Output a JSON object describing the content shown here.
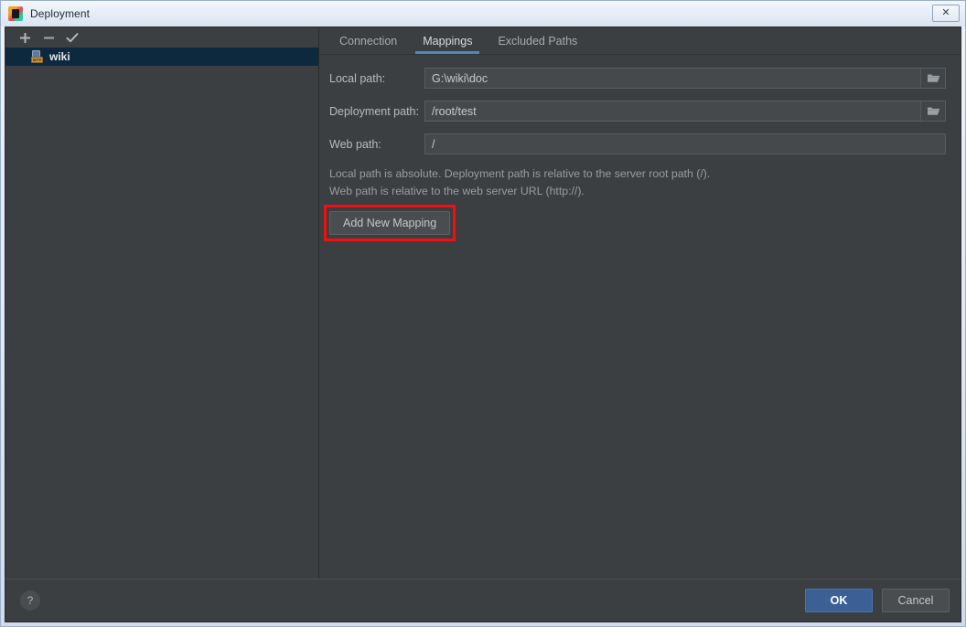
{
  "window": {
    "title": "Deployment",
    "app_icon": "pycharm-icon",
    "close_label": "✕"
  },
  "left_panel": {
    "toolbar": [
      {
        "name": "add-server-button",
        "icon": "plus-icon",
        "label": "+"
      },
      {
        "name": "remove-server-button",
        "icon": "minus-icon",
        "label": "−"
      },
      {
        "name": "use-as-default-button",
        "icon": "check-icon",
        "label": "✓"
      }
    ],
    "servers": [
      {
        "label": "wiki",
        "icon": "sftp-server-icon",
        "badge": "SFTP",
        "selected": true
      }
    ]
  },
  "tabs": [
    {
      "label": "Connection",
      "active": false
    },
    {
      "label": "Mappings",
      "active": true
    },
    {
      "label": "Excluded Paths",
      "active": false
    }
  ],
  "mappings_form": {
    "fields": [
      {
        "label": "Local path:",
        "value": "G:\\wiki\\doc",
        "placeholder": "",
        "has_browse": true,
        "name": "local-path"
      },
      {
        "label": "Deployment path:",
        "value": "/root/test",
        "placeholder": "",
        "has_browse": true,
        "name": "deployment-path"
      },
      {
        "label": "Web path:",
        "value": "/",
        "placeholder": "",
        "has_browse": false,
        "name": "web-path"
      }
    ],
    "hint_line_1": "Local path is absolute. Deployment path is relative to the server root path (/).",
    "hint_line_2": "Web path is relative to the web server URL (http://).",
    "add_mapping_label": "Add New Mapping"
  },
  "footer": {
    "help_label": "?",
    "ok_label": "OK",
    "cancel_label": "Cancel"
  },
  "annotation": {
    "highlight_color": "#f50e0e",
    "target": "add-mapping-button"
  }
}
